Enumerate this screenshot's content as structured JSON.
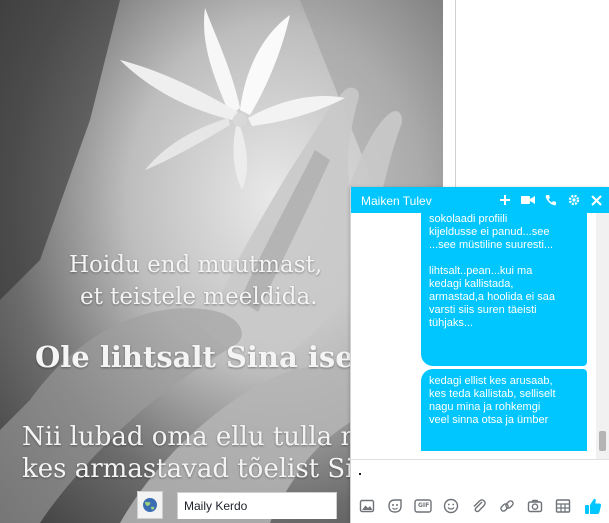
{
  "photo": {
    "quote_line_1": "Hoidu end muutmast,",
    "quote_line_2": "et teistele meeldida.",
    "quote_line_3": "Ole lihtsalt Sina ise.",
    "quote_line_4": "Nii lubad oma ellu tulla ne",
    "quote_line_5": "kes armastavad tõelist Sin"
  },
  "bottom_bar": {
    "globe_icon": "globe-icon",
    "friend_name": "Maily Kerdo"
  },
  "chat": {
    "title": "Maiken Tulev",
    "header_icons": [
      "plus-icon",
      "video-icon",
      "phone-icon",
      "gear-icon",
      "close-icon"
    ],
    "messages": [
      {
        "text": "profiili järgi...endal lyllit ja\nsokolaadi profiili\nkijeldusse ei panud...see\n...see müstiline suuresti...\n\nlihtsalt..pean...kui ma\nkedagi kallistada,\narmastad,a hoolida ei saa\nvarsti siis suren täeisti\ntühjaks..."
      },
      {
        "text": "kedagi ellist kes arusaab,\nkes teda kallistab, selliselt\nnagu mina ja rohkemgi\nveel sinna otsa ja ümber"
      }
    ],
    "toolbar_icons": [
      "image-icon",
      "sticker-icon",
      "gif-icon",
      "emoji-icon",
      "attachment-icon",
      "link-icon",
      "camera-icon",
      "table-icon",
      "thumbs-up-icon"
    ],
    "gif_label": "GIF",
    "accent_color": "#00c6ff"
  }
}
